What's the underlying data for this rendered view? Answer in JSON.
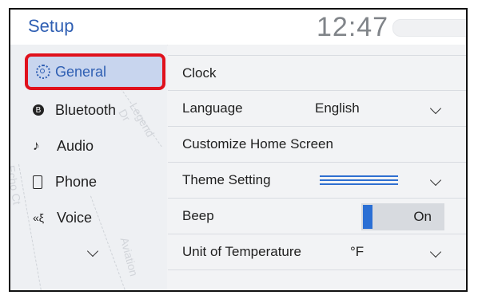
{
  "header": {
    "title": "Setup",
    "time": "12:47"
  },
  "sidebar": {
    "items": [
      {
        "label": "General",
        "icon": "gear-icon",
        "active": true
      },
      {
        "label": "Bluetooth",
        "icon": "bluetooth-icon",
        "glyph": "B"
      },
      {
        "label": "Audio",
        "icon": "music-note-icon",
        "glyph": "♪"
      },
      {
        "label": "Phone",
        "icon": "phone-icon"
      },
      {
        "label": "Voice",
        "icon": "voice-icon",
        "glyph": "«ξ"
      }
    ],
    "map_labels": [
      "Legend Dr",
      "Echo Ct",
      "Aviation"
    ]
  },
  "settings": {
    "clock": {
      "label": "Clock"
    },
    "language": {
      "label": "Language",
      "value": "English"
    },
    "home": {
      "label": "Customize Home Screen"
    },
    "theme": {
      "label": "Theme Setting"
    },
    "beep": {
      "label": "Beep",
      "value": "On"
    },
    "temperature": {
      "label": "Unit of Temperature",
      "value": "°F"
    }
  },
  "colors": {
    "accent": "#2f5fb3",
    "highlight_border": "#e0111c",
    "toggle_on": "#2b6fd4"
  }
}
